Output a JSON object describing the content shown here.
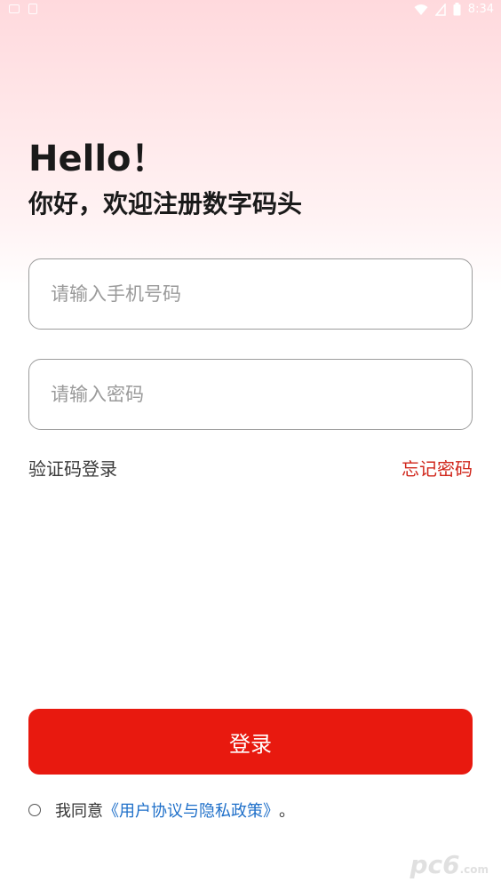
{
  "status_bar": {
    "time": "8:34"
  },
  "header": {
    "title": "Hello！",
    "subtitle": "你好，欢迎注册数字码头"
  },
  "form": {
    "phone_placeholder": "请输入手机号码",
    "password_placeholder": "请输入密码",
    "sms_login_label": "验证码登录",
    "forgot_password_label": "忘记密码",
    "login_label": "登录"
  },
  "agreement": {
    "prefix": "我同意",
    "link_text": "《用户协议与隐私政策》",
    "suffix": "。"
  },
  "watermark": {
    "brand": "pc6",
    "domain": ".com"
  },
  "colors": {
    "accent": "#e8190f",
    "link_red": "#d0261b",
    "link_blue": "#1e6fc9",
    "header_gradient_top": "#ffd9dd"
  },
  "icons": {
    "status_left": [
      "notification-icon",
      "app-icon"
    ],
    "status_right": [
      "wifi-icon",
      "signal-icon",
      "battery-icon"
    ],
    "agreement": "radio-unchecked-icon"
  }
}
